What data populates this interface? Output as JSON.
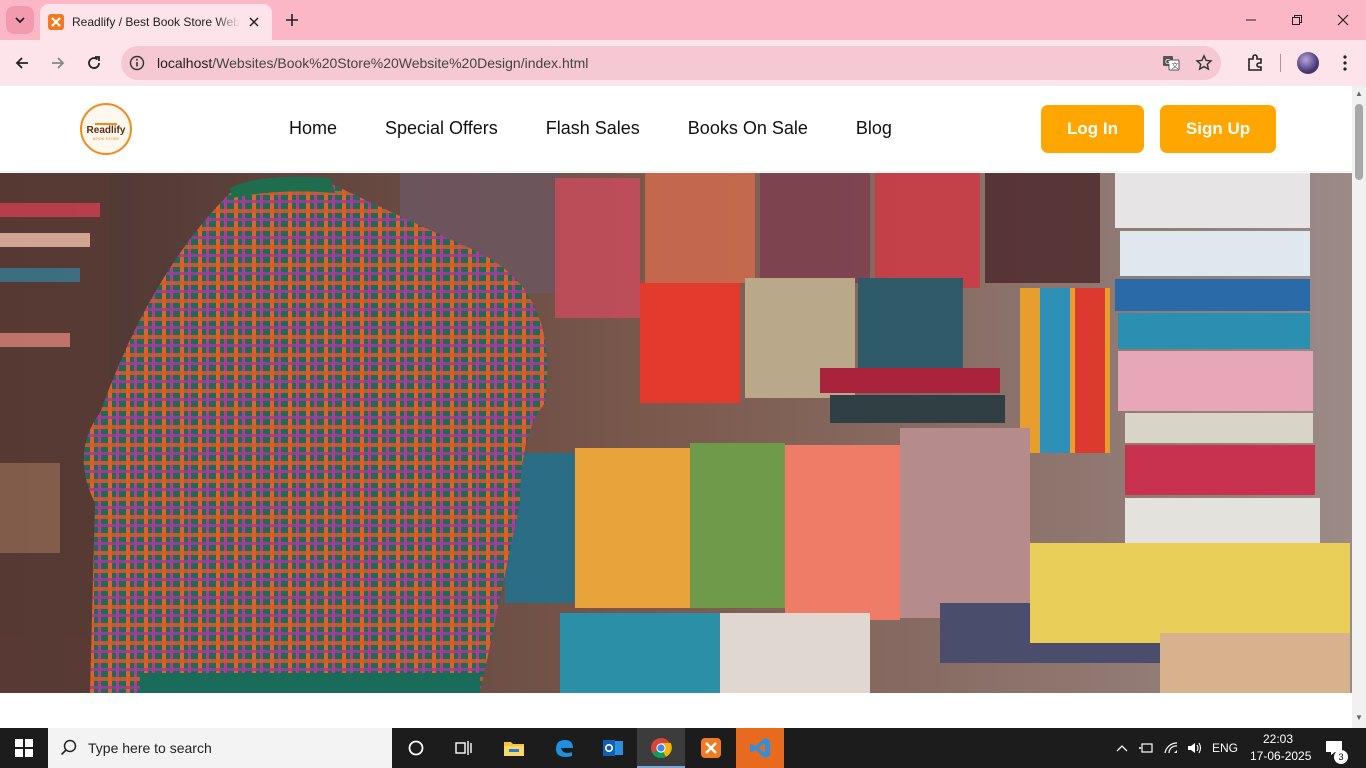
{
  "browser": {
    "tab": {
      "title": "Readlify / Best Book Store Website Design",
      "favicon": "xampp-icon"
    },
    "url": {
      "host": "localhost",
      "path": "/Websites/Book%20Store%20Website%20Design/index.html"
    },
    "colors": {
      "tabbar": "#fbb7c6",
      "toolbar": "#fde3ea",
      "omnibox": "#f5c8d3"
    }
  },
  "site": {
    "logo": {
      "text": "Readlify",
      "subtext": "BOOK STORE"
    },
    "nav": [
      {
        "label": "Home"
      },
      {
        "label": "Special Offers"
      },
      {
        "label": "Flash Sales"
      },
      {
        "label": "Books On Sale"
      },
      {
        "label": "Blog"
      }
    ],
    "buttons": {
      "login": "Log In",
      "signup": "Sign Up"
    },
    "accent": "#ffa600",
    "hero": {
      "image": "bookstore-photo"
    }
  },
  "taskbar": {
    "search_placeholder": "Type here to search",
    "language": "ENG",
    "time": "22:03",
    "date": "17-06-2025",
    "notifications": "3"
  }
}
